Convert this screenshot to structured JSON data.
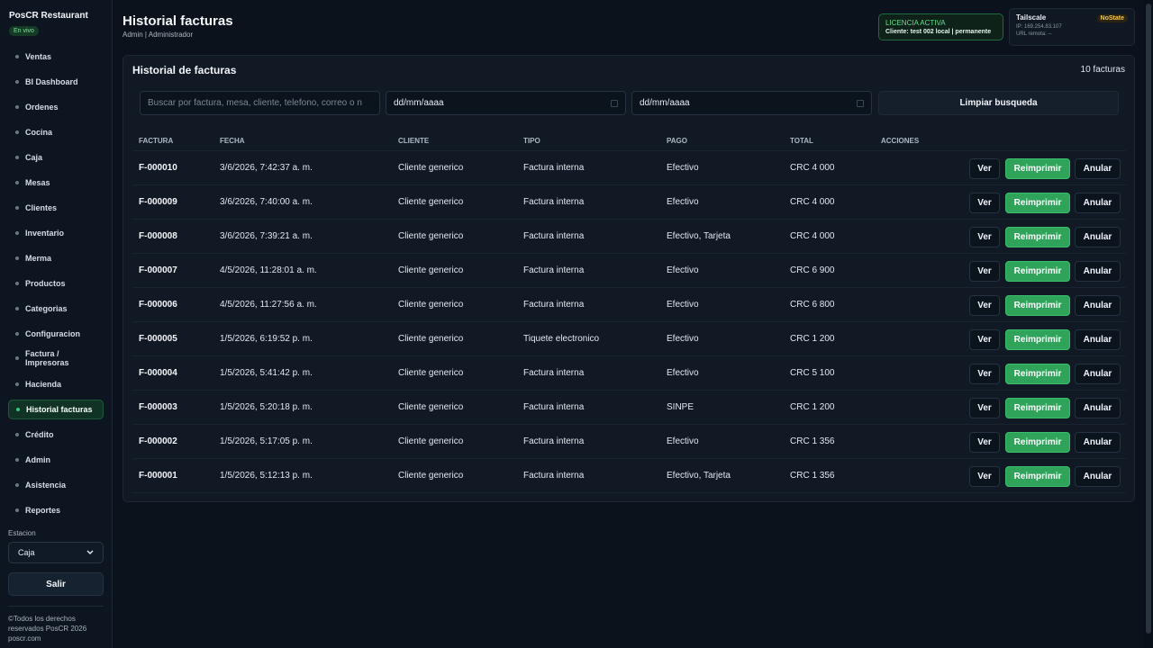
{
  "sidebar": {
    "brand": "PosCR Restaurant",
    "live_badge": "En vivo",
    "items": [
      {
        "label": "Ventas"
      },
      {
        "label": "BI Dashboard"
      },
      {
        "label": "Ordenes"
      },
      {
        "label": "Cocina"
      },
      {
        "label": "Caja"
      },
      {
        "label": "Mesas"
      },
      {
        "label": "Clientes"
      },
      {
        "label": "Inventario"
      },
      {
        "label": "Merma"
      },
      {
        "label": "Productos"
      },
      {
        "label": "Categorias"
      },
      {
        "label": "Configuracion"
      },
      {
        "label": "Factura / Impresoras"
      },
      {
        "label": "Hacienda"
      },
      {
        "label": "Historial facturas",
        "active": true
      },
      {
        "label": "Crédito"
      },
      {
        "label": "Admin"
      },
      {
        "label": "Asistencia"
      },
      {
        "label": "Reportes"
      }
    ],
    "station_label": "Estacion",
    "station_value": "Caja",
    "logout_label": "Salir",
    "footer_line1": "©Todos los derechos",
    "footer_line2": "reservados PosCR 2026",
    "footer_line3": "poscr.com"
  },
  "header": {
    "title": "Historial facturas",
    "subtitle": "Admin | Administrador",
    "license_title": "LICENCIA ACTIVA",
    "license_detail": "Cliente: test 002 local | permanente",
    "tailscale_title": "Tailscale",
    "tailscale_badge": "NoState",
    "tailscale_ip": "IP: 169.254.83.107",
    "tailscale_url": "URL remota: --"
  },
  "main": {
    "card_title": "Historial de facturas",
    "count": "10 facturas",
    "search_placeholder": "Buscar por factura, mesa, cliente, telefono, correo o n",
    "date_from": "dd/mm/aaaa",
    "date_to": "dd/mm/aaaa",
    "clear_label": "Limpiar busqueda",
    "columns": [
      "FACTURA",
      "FECHA",
      "CLIENTE",
      "TIPO",
      "PAGO",
      "TOTAL",
      "ACCIONES"
    ],
    "actions": {
      "view": "Ver",
      "reprint": "Reimprimir",
      "void": "Anular"
    },
    "rows": [
      {
        "invoice": "F-000010",
        "date": "3/6/2026, 7:42:37 a. m.",
        "client": "Cliente generico",
        "type": "Factura interna",
        "payment": "Efectivo",
        "total": "CRC 4 000"
      },
      {
        "invoice": "F-000009",
        "date": "3/6/2026, 7:40:00 a. m.",
        "client": "Cliente generico",
        "type": "Factura interna",
        "payment": "Efectivo",
        "total": "CRC 4 000"
      },
      {
        "invoice": "F-000008",
        "date": "3/6/2026, 7:39:21 a. m.",
        "client": "Cliente generico",
        "type": "Factura interna",
        "payment": "Efectivo, Tarjeta",
        "total": "CRC 4 000"
      },
      {
        "invoice": "F-000007",
        "date": "4/5/2026, 11:28:01 a. m.",
        "client": "Cliente generico",
        "type": "Factura interna",
        "payment": "Efectivo",
        "total": "CRC 6 900"
      },
      {
        "invoice": "F-000006",
        "date": "4/5/2026, 11:27:56 a. m.",
        "client": "Cliente generico",
        "type": "Factura interna",
        "payment": "Efectivo",
        "total": "CRC 6 800"
      },
      {
        "invoice": "F-000005",
        "date": "1/5/2026, 6:19:52 p. m.",
        "client": "Cliente generico",
        "type": "Tiquete electronico",
        "payment": "Efectivo",
        "total": "CRC 1 200"
      },
      {
        "invoice": "F-000004",
        "date": "1/5/2026, 5:41:42 p. m.",
        "client": "Cliente generico",
        "type": "Factura interna",
        "payment": "Efectivo",
        "total": "CRC 5 100"
      },
      {
        "invoice": "F-000003",
        "date": "1/5/2026, 5:20:18 p. m.",
        "client": "Cliente generico",
        "type": "Factura interna",
        "payment": "SINPE",
        "total": "CRC 1 200"
      },
      {
        "invoice": "F-000002",
        "date": "1/5/2026, 5:17:05 p. m.",
        "client": "Cliente generico",
        "type": "Factura interna",
        "payment": "Efectivo",
        "total": "CRC 1 356"
      },
      {
        "invoice": "F-000001",
        "date": "1/5/2026, 5:12:13 p. m.",
        "client": "Cliente generico",
        "type": "Factura interna",
        "payment": "Efectivo, Tarjeta",
        "total": "CRC 1 356"
      }
    ]
  }
}
